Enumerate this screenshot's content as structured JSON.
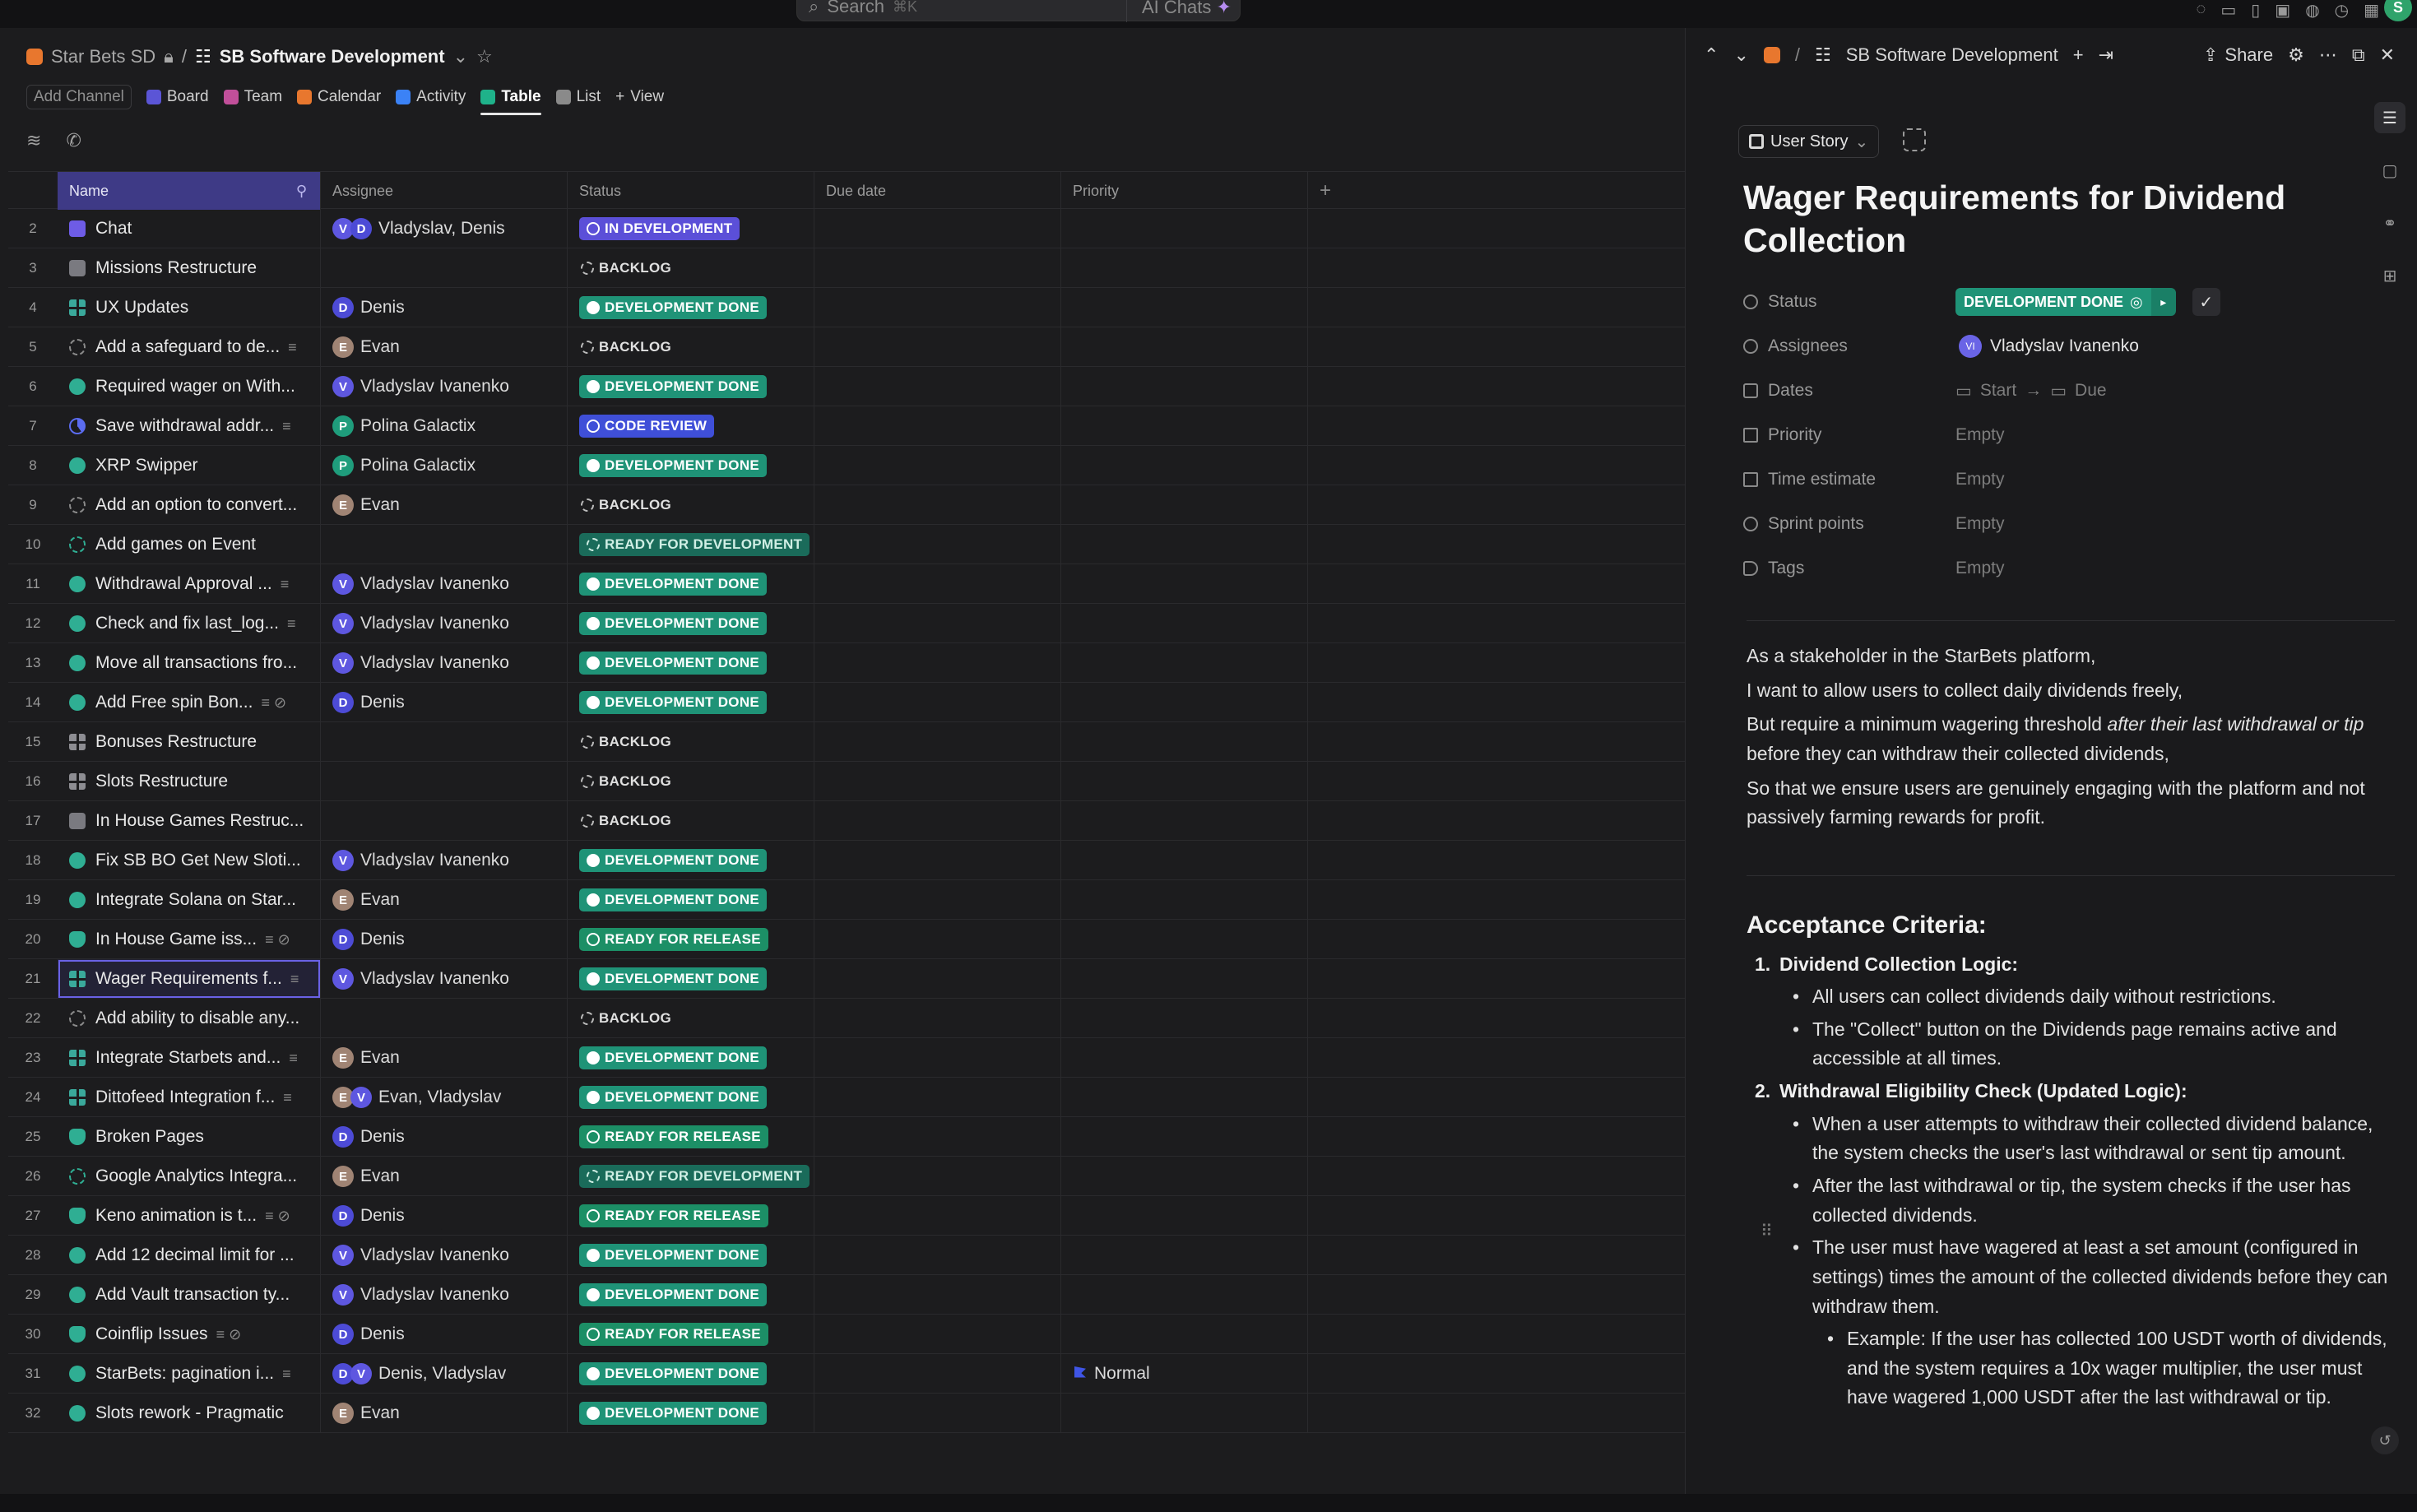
{
  "topbar": {
    "search_placeholder": "Search",
    "search_shortcut": "⌘K",
    "ai_label": "AI Chats",
    "avatar_letter": "S"
  },
  "breadcrumb": {
    "space": "Star Bets SD",
    "list": "SB Software Development"
  },
  "viewbar": {
    "add_channel": "Add Channel",
    "tabs": [
      {
        "label": "Board",
        "color": "#5b55d6"
      },
      {
        "label": "Team",
        "color": "#c14f9a"
      },
      {
        "label": "Calendar",
        "color": "#e8772e"
      },
      {
        "label": "Activity",
        "color": "#3b82f6"
      },
      {
        "label": "Table",
        "color": "#1fb28a"
      },
      {
        "label": "List",
        "color": "#8a8a8a"
      }
    ],
    "add_view": "View"
  },
  "table": {
    "headers": {
      "name": "Name",
      "assignee": "Assignee",
      "status": "Status",
      "due": "Due date",
      "priority": "Priority"
    },
    "rows": [
      {
        "n": "2",
        "icon": "chat",
        "name": "Chat",
        "avatars": [
          "V",
          "D"
        ],
        "assignee": "Vladyslav, Denis",
        "status": "IN DEVELOPMENT",
        "sclass": "p-dev"
      },
      {
        "n": "3",
        "icon": "box",
        "name": "Missions Restructure",
        "avatars": [],
        "assignee": "",
        "status": "BACKLOG",
        "sclass": "p-back"
      },
      {
        "n": "4",
        "icon": "grid2",
        "name": "UX Updates",
        "avatars": [
          "D"
        ],
        "assignee": "Denis",
        "status": "DEVELOPMENT DONE",
        "sclass": "p-done"
      },
      {
        "n": "5",
        "icon": "dash",
        "name": "Add a safeguard to de...",
        "extra": "≡",
        "avatars": [
          "E"
        ],
        "assignee": "Evan",
        "status": "BACKLOG",
        "sclass": "p-back"
      },
      {
        "n": "6",
        "icon": "check",
        "name": "Required wager on With...",
        "avatars": [
          "V"
        ],
        "assignee": "Vladyslav Ivanenko",
        "status": "DEVELOPMENT DONE",
        "sclass": "p-done"
      },
      {
        "n": "7",
        "icon": "half",
        "name": "Save withdrawal addr...",
        "extra": "≡",
        "avatars": [
          "P"
        ],
        "assignee": "Polina Galactix",
        "status": "CODE REVIEW",
        "sclass": "p-rev"
      },
      {
        "n": "8",
        "icon": "check",
        "name": "XRP Swipper",
        "avatars": [
          "P"
        ],
        "assignee": "Polina Galactix",
        "status": "DEVELOPMENT DONE",
        "sclass": "p-done"
      },
      {
        "n": "9",
        "icon": "dash",
        "name": "Add an option to convert...",
        "avatars": [
          "E"
        ],
        "assignee": "Evan",
        "status": "BACKLOG",
        "sclass": "p-back"
      },
      {
        "n": "10",
        "icon": "dashg",
        "name": "Add games on Event",
        "avatars": [],
        "assignee": "",
        "status": "READY FOR DEVELOPMENT",
        "sclass": "p-ready"
      },
      {
        "n": "11",
        "icon": "check",
        "name": "Withdrawal Approval ...",
        "extra": "≡",
        "avatars": [
          "V"
        ],
        "assignee": "Vladyslav Ivanenko",
        "status": "DEVELOPMENT DONE",
        "sclass": "p-done"
      },
      {
        "n": "12",
        "icon": "check",
        "name": "Check and fix last_log...",
        "extra": "≡",
        "avatars": [
          "V"
        ],
        "assignee": "Vladyslav Ivanenko",
        "status": "DEVELOPMENT DONE",
        "sclass": "p-done"
      },
      {
        "n": "13",
        "icon": "check",
        "name": "Move all transactions fro...",
        "avatars": [
          "V"
        ],
        "assignee": "Vladyslav Ivanenko",
        "status": "DEVELOPMENT DONE",
        "sclass": "p-done"
      },
      {
        "n": "14",
        "icon": "check",
        "name": "Add Free spin Bon...",
        "extra": "≡ ⊘",
        "avatars": [
          "D"
        ],
        "assignee": "Denis",
        "status": "DEVELOPMENT DONE",
        "sclass": "p-done"
      },
      {
        "n": "15",
        "icon": "grid3",
        "name": "Bonuses Restructure",
        "avatars": [],
        "assignee": "",
        "status": "BACKLOG",
        "sclass": "p-back"
      },
      {
        "n": "16",
        "icon": "grid3",
        "name": "Slots Restructure",
        "avatars": [],
        "assignee": "",
        "status": "BACKLOG",
        "sclass": "p-back"
      },
      {
        "n": "17",
        "icon": "box",
        "name": "In House Games Restruc...",
        "avatars": [],
        "assignee": "",
        "status": "BACKLOG",
        "sclass": "p-back"
      },
      {
        "n": "18",
        "icon": "check",
        "name": "Fix SB BO Get New Sloti...",
        "avatars": [
          "V"
        ],
        "assignee": "Vladyslav Ivanenko",
        "status": "DEVELOPMENT DONE",
        "sclass": "p-done"
      },
      {
        "n": "19",
        "icon": "check",
        "name": "Integrate Solana on Star...",
        "avatars": [
          "E"
        ],
        "assignee": "Evan",
        "status": "DEVELOPMENT DONE",
        "sclass": "p-done"
      },
      {
        "n": "20",
        "icon": "bug",
        "name": "In House Game iss...",
        "extra": "≡ ⊘",
        "avatars": [
          "D"
        ],
        "assignee": "Denis",
        "status": "READY FOR RELEASE",
        "sclass": "p-rel"
      },
      {
        "n": "21",
        "icon": "grid2",
        "name": "Wager Requirements f...",
        "extra": "≡",
        "avatars": [
          "V"
        ],
        "assignee": "Vladyslav Ivanenko",
        "status": "DEVELOPMENT DONE",
        "sclass": "p-done",
        "selected": true
      },
      {
        "n": "22",
        "icon": "dash",
        "name": "Add ability to disable any...",
        "avatars": [],
        "assignee": "",
        "status": "BACKLOG",
        "sclass": "p-back"
      },
      {
        "n": "23",
        "icon": "grid2",
        "name": "Integrate Starbets and...",
        "extra": "≡",
        "avatars": [
          "E"
        ],
        "assignee": "Evan",
        "status": "DEVELOPMENT DONE",
        "sclass": "p-done"
      },
      {
        "n": "24",
        "icon": "grid2",
        "name": "Dittofeed Integration f...",
        "extra": "≡",
        "avatars": [
          "E",
          "V"
        ],
        "assignee": "Evan, Vladyslav",
        "status": "DEVELOPMENT DONE",
        "sclass": "p-done"
      },
      {
        "n": "25",
        "icon": "bug",
        "name": "Broken Pages",
        "avatars": [
          "D"
        ],
        "assignee": "Denis",
        "status": "READY FOR RELEASE",
        "sclass": "p-rel"
      },
      {
        "n": "26",
        "icon": "dashg",
        "name": "Google Analytics Integra...",
        "avatars": [
          "E"
        ],
        "assignee": "Evan",
        "status": "READY FOR DEVELOPMENT",
        "sclass": "p-ready"
      },
      {
        "n": "27",
        "icon": "bug",
        "name": "Keno animation is t...",
        "extra": "≡ ⊘",
        "avatars": [
          "D"
        ],
        "assignee": "Denis",
        "status": "READY FOR RELEASE",
        "sclass": "p-rel"
      },
      {
        "n": "28",
        "icon": "check",
        "name": "Add 12 decimal limit for ...",
        "avatars": [
          "V"
        ],
        "assignee": "Vladyslav Ivanenko",
        "status": "DEVELOPMENT DONE",
        "sclass": "p-done"
      },
      {
        "n": "29",
        "icon": "check",
        "name": "Add Vault transaction ty...",
        "avatars": [
          "V"
        ],
        "assignee": "Vladyslav Ivanenko",
        "status": "DEVELOPMENT DONE",
        "sclass": "p-done"
      },
      {
        "n": "30",
        "icon": "bug",
        "name": "Coinflip Issues",
        "extra": "≡ ⊘",
        "avatars": [
          "D"
        ],
        "assignee": "Denis",
        "status": "READY FOR RELEASE",
        "sclass": "p-rel"
      },
      {
        "n": "31",
        "icon": "check",
        "name": "StarBets: pagination i...",
        "extra": "≡",
        "avatars": [
          "D",
          "V"
        ],
        "assignee": "Denis, Vladyslav",
        "status": "DEVELOPMENT DONE",
        "sclass": "p-done",
        "priority": "Normal"
      },
      {
        "n": "32",
        "icon": "check",
        "name": "Slots rework - Pragmatic",
        "avatars": [
          "E"
        ],
        "assignee": "Evan",
        "status": "DEVELOPMENT DONE",
        "sclass": "p-done"
      }
    ]
  },
  "detail": {
    "list_name": "SB Software Development",
    "share": "Share",
    "task_type": "User Story",
    "title": "Wager Requirements for Dividend Collection",
    "props": {
      "status_label": "Status",
      "status_value": "DEVELOPMENT DONE",
      "assignees_label": "Assignees",
      "assignee_initials": "VI",
      "assignee_name": "Vladyslav Ivanenko",
      "dates_label": "Dates",
      "date_start": "Start",
      "date_due": "Due",
      "priority_label": "Priority",
      "priority_value": "Empty",
      "time_label": "Time estimate",
      "time_value": "Empty",
      "sprint_label": "Sprint points",
      "sprint_value": "Empty",
      "tags_label": "Tags",
      "tags_value": "Empty"
    },
    "description": {
      "l1": "As a stakeholder in the StarBets platform,",
      "l2": "I want to allow users to collect daily dividends freely,",
      "l3a": "But require a minimum wagering threshold ",
      "l3em": "after their last withdrawal or tip",
      "l3b": " before they can withdraw their collected dividends,",
      "l4": "So that we ensure users are genuinely engaging with the platform and not passively farming rewards for profit."
    },
    "acceptance": {
      "heading": "Acceptance Criteria:",
      "i1": "Dividend Collection Logic:",
      "i1b1": "All users can collect dividends daily without restrictions.",
      "i1b2": "The \"Collect\" button on the Dividends page remains active and accessible at all times.",
      "i2": "Withdrawal Eligibility Check (Updated Logic):",
      "i2b1": "When a user attempts to withdraw their collected dividend balance, the system checks the user's last withdrawal or sent tip amount.",
      "i2b2": "After the last withdrawal or tip, the system checks if the user has collected dividends.",
      "i2b3": "The user must have wagered at least a set amount (configured in settings) times the amount of the collected dividends before they can withdraw them.",
      "i2b3s1": "Example: If the user has collected 100 USDT worth of dividends, and the system requires a 10x wager multiplier, the user must have wagered 1,000 USDT after the last withdrawal or tip."
    }
  }
}
